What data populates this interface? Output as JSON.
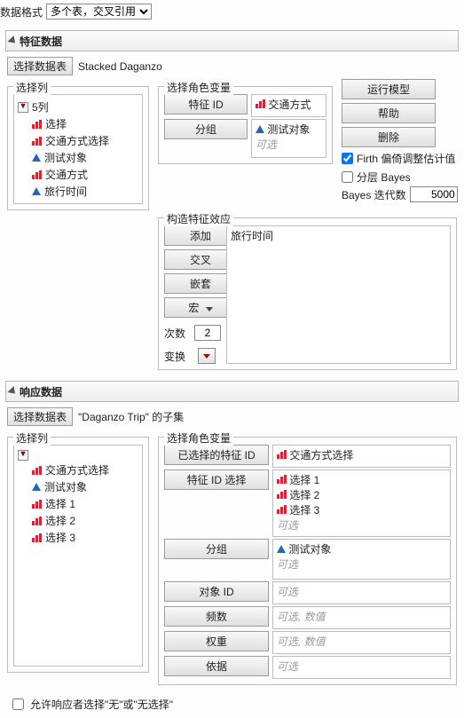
{
  "top": {
    "formatLabel": "数据格式",
    "formatValue": "多个表，交叉引用"
  },
  "feature": {
    "title": "特征数据",
    "selectTableBtn": "选择数据表",
    "tableName": "Stacked Daganzo",
    "selectColsLegend": "选择列",
    "colsHeader": "5列",
    "cols": [
      "选择",
      "交通方式选择",
      "测试对象",
      "交通方式",
      "旅行时间"
    ],
    "colTypes": [
      "red",
      "red",
      "blue",
      "red",
      "blue"
    ],
    "roleLegend": "选择角色变量",
    "roleFeatureIdBtn": "特征 ID",
    "roleFeatureIdVal": "交通方式",
    "roleGroupBtn": "分组",
    "roleGroupVal": "测试对象",
    "roleGroupHint": "可选",
    "actions": {
      "run": "运行模型",
      "help": "帮助",
      "delete": "删除"
    },
    "firthLabel": "Firth 偏倚调整估计值",
    "bayesLabel": "分层 Bayes",
    "iterLabel": "Bayes 迭代数",
    "iterValue": "5000",
    "constructLegend": "构造特征效应",
    "constructBtns": {
      "add": "添加",
      "cross": "交叉",
      "nest": "嵌套",
      "macro": "宏"
    },
    "constructEffect": "旅行时间",
    "countLabel": "次数",
    "countValue": "2",
    "transformLabel": "变换"
  },
  "response": {
    "title": "响应数据",
    "selectTableBtn": "选择数据表",
    "tableName": "\"Daganzo Trip\" 的子集",
    "selectColsLegend": "选择列",
    "cols": [
      "交通方式选择",
      "测试对象",
      "选择 1",
      "选择 2",
      "选择 3"
    ],
    "colTypes": [
      "red",
      "blue",
      "red",
      "red",
      "red"
    ],
    "roleLegend": "选择角色变量",
    "rows": {
      "selectedFeatureIdBtn": "已选择的特征 ID",
      "selectedFeatureIdVal": "交通方式选择",
      "featureIdChoiceBtn": "特征 ID 选择",
      "featureIdChoiceVals": [
        "选择 1",
        "选择 2",
        "选择 3"
      ],
      "featureIdChoiceHint": "可选",
      "groupBtn": "分组",
      "groupVal": "测试对象",
      "groupHint": "可选",
      "objIdBtn": "对象 ID",
      "objIdHint": "可选",
      "freqBtn": "频数",
      "freqHint": "可选, 数值",
      "weightBtn": "权重",
      "weightHint": "可选, 数值",
      "byBtn": "依据",
      "byHint": "可选"
    }
  },
  "bottom": {
    "allowNone": "允许响应者选择\"无\"或\"无选择\""
  }
}
